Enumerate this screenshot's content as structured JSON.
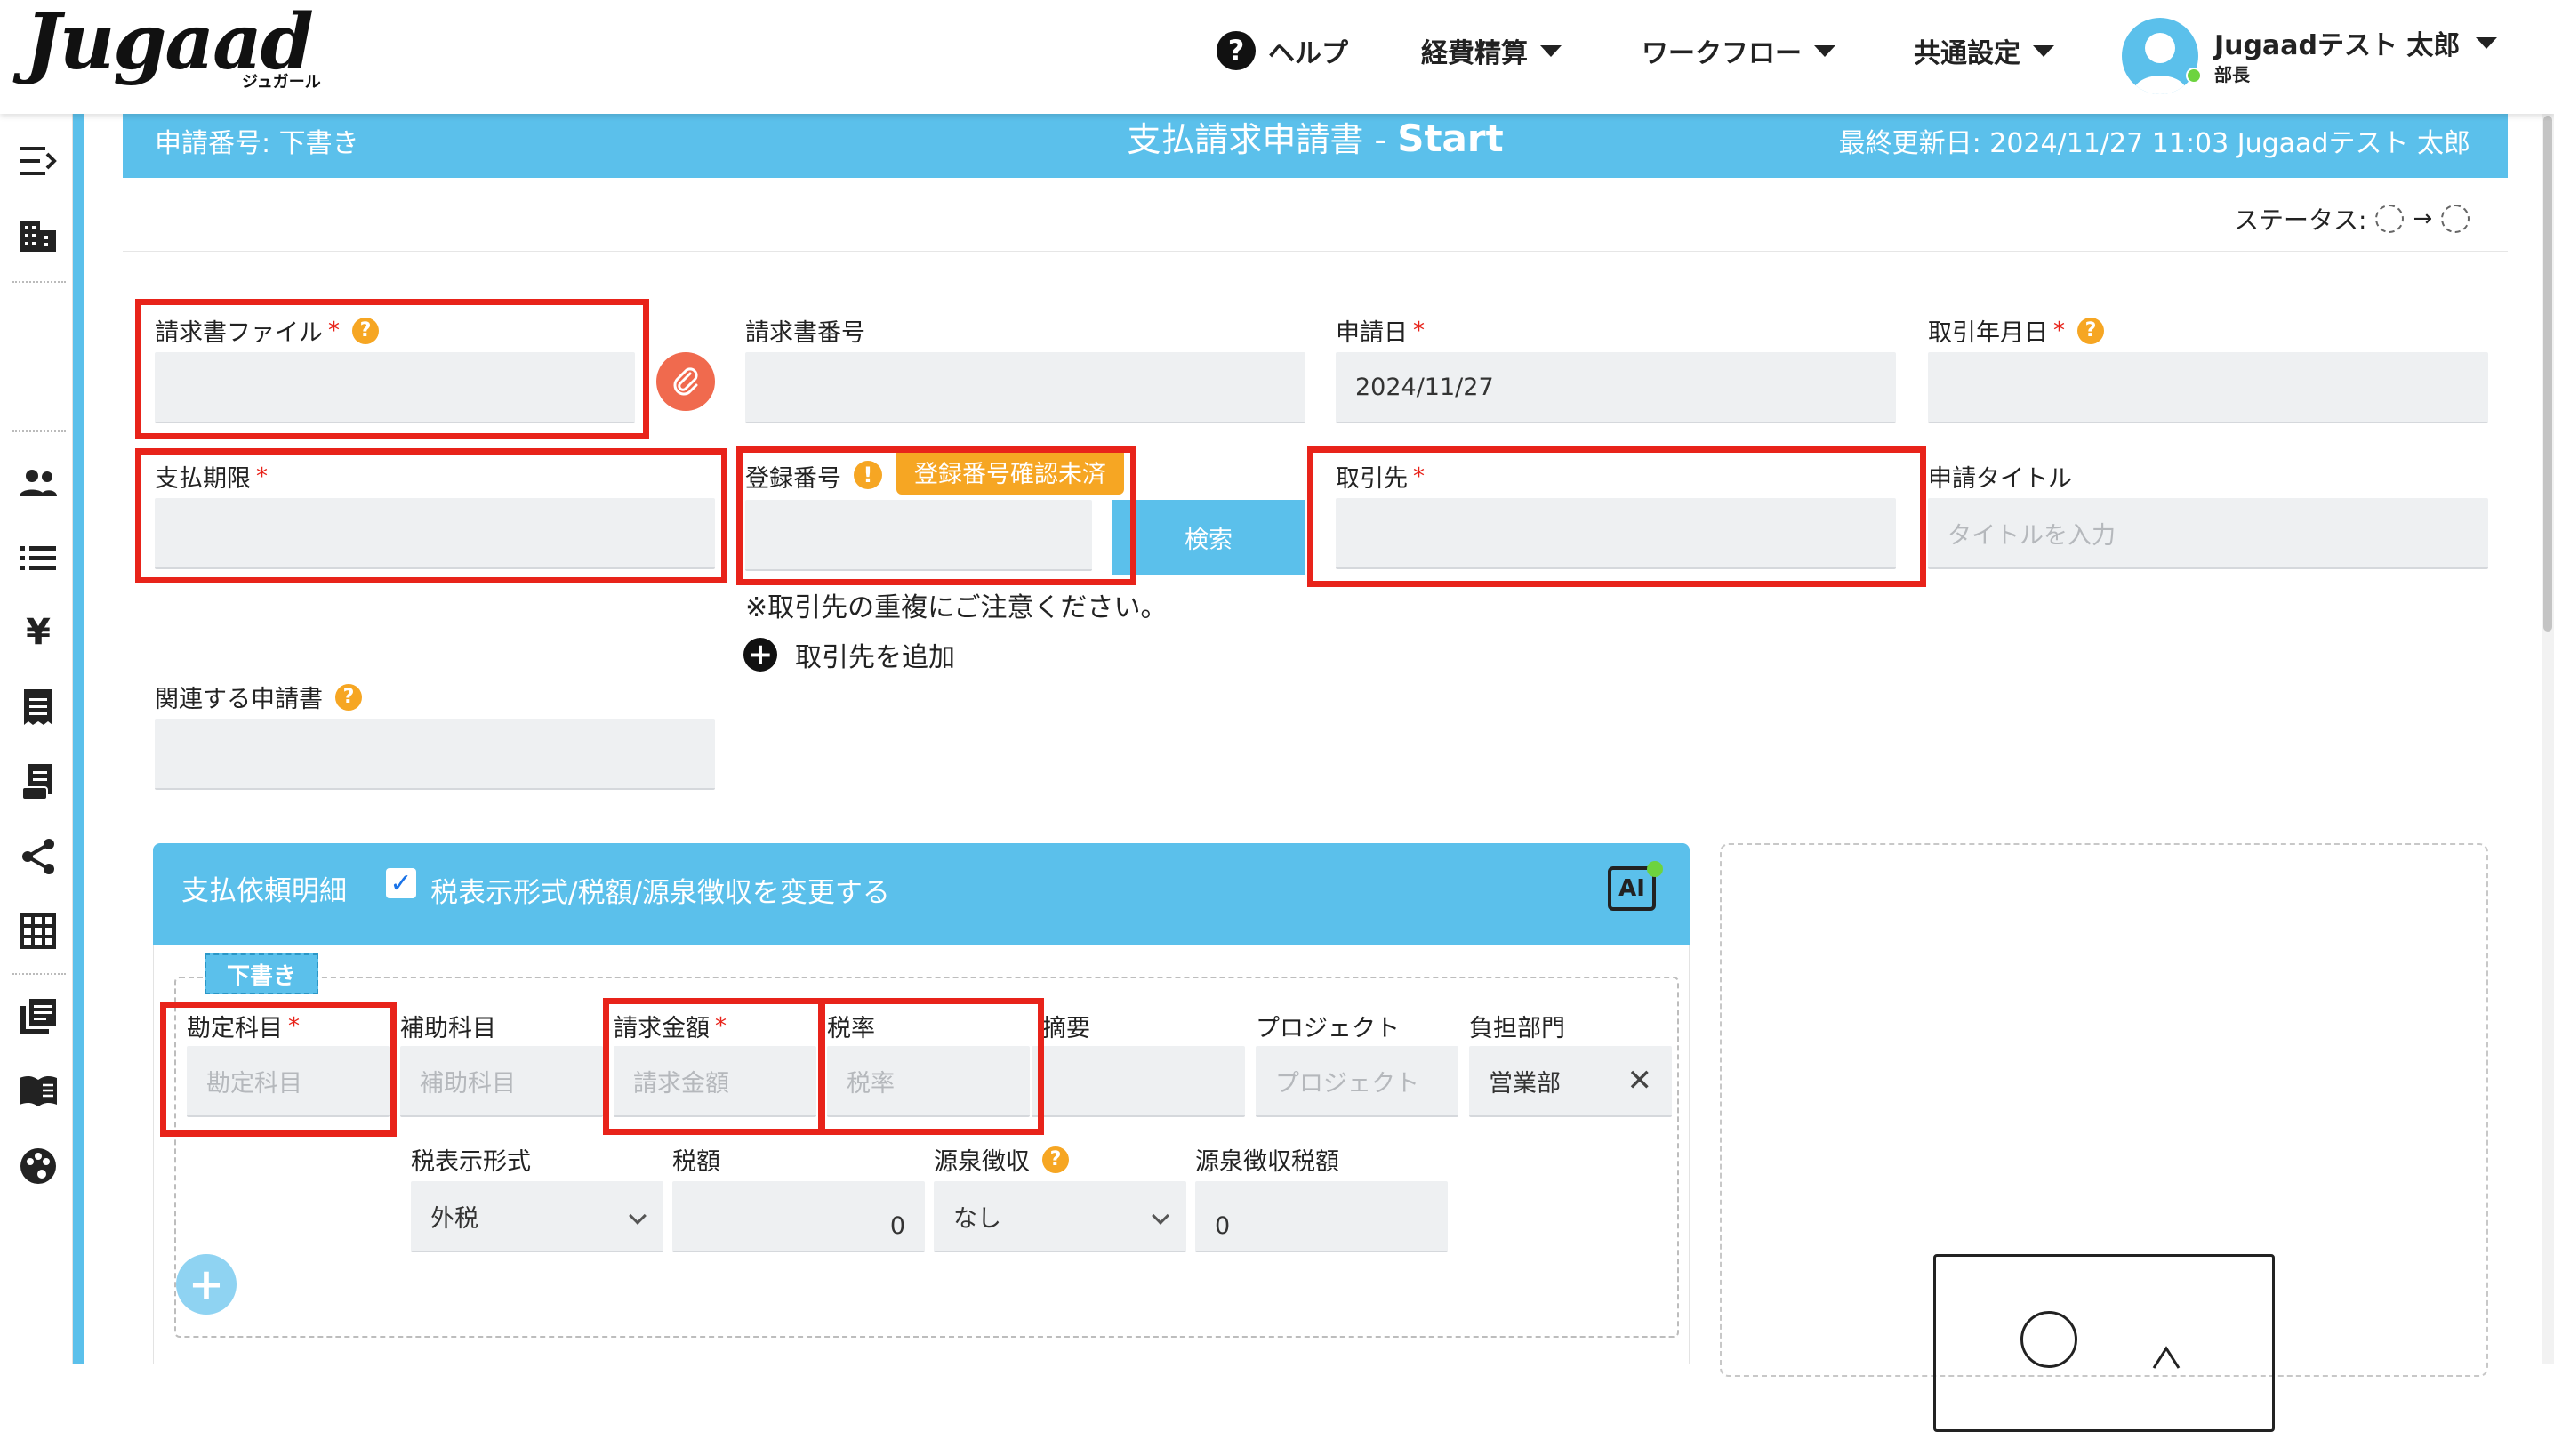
{
  "header": {
    "logo": "Jugaad",
    "logo_sub": "ジュガール",
    "help": "ヘルプ",
    "nav": [
      "経費精算",
      "ワークフロー",
      "共通設定"
    ],
    "user_name": "Jugaadテスト 太郎",
    "user_role": "部長"
  },
  "sidebar": {
    "icons": [
      "collapse-menu-icon",
      "building-icon",
      "people-icon",
      "list-icon",
      "yen-icon",
      "receipt-icon",
      "invoice-icon",
      "share-icon",
      "grid-icon",
      "library-icon",
      "book-icon",
      "palette-icon"
    ]
  },
  "form_header": {
    "application_number": "申請番号: 下書き",
    "title_prefix": "支払請求申請書 -",
    "title_step": "Start",
    "last_updated": "最終更新日: 2024/11/27 11:03  Jugaadテスト 太郎",
    "status_label": "ステータス:"
  },
  "fields": {
    "invoice_file": {
      "label": "請求書ファイル",
      "value": ""
    },
    "invoice_number": {
      "label": "請求書番号",
      "value": ""
    },
    "application_date": {
      "label": "申請日",
      "value": "2024/11/27"
    },
    "transaction_date": {
      "label": "取引年月日",
      "value": ""
    },
    "payment_due": {
      "label": "支払期限",
      "value": ""
    },
    "registration_number": {
      "label": "登録番号",
      "value": "",
      "warning": "登録番号確認未済"
    },
    "search_button": "検索",
    "vendor": {
      "label": "取引先",
      "value": ""
    },
    "request_title": {
      "label": "申請タイトル",
      "placeholder": "タイトルを入力"
    },
    "duplicate_note": "※取引先の重複にご注意ください。",
    "add_vendor": "取引先を追加",
    "related_applications": {
      "label": "関連する申請書",
      "value": ""
    }
  },
  "detail": {
    "title": "支払依頼明細",
    "checkbox_label": "税表示形式/税額/源泉徴収を変更する",
    "checkbox_checked": true,
    "draft_tag": "下書き",
    "ai_label": "AI",
    "row1": {
      "account": {
        "label": "勘定科目",
        "placeholder": "勘定科目"
      },
      "sub_account": {
        "label": "補助科目",
        "placeholder": "補助科目"
      },
      "amount": {
        "label": "請求金額",
        "placeholder": "請求金額"
      },
      "tax_rate": {
        "label": "税率",
        "placeholder": "税率"
      },
      "summary": {
        "label": "摘要",
        "value": ""
      },
      "project": {
        "label": "プロジェクト",
        "placeholder": "プロジェクト"
      },
      "department": {
        "label": "負担部門",
        "value": "営業部"
      }
    },
    "row2": {
      "tax_display": {
        "label": "税表示形式",
        "value": "外税"
      },
      "tax_amount": {
        "label": "税額",
        "value": "0"
      },
      "withholding": {
        "label": "源泉徴収",
        "value": "なし"
      },
      "withholding_amount": {
        "label": "源泉徴収税額",
        "value": "0"
      }
    }
  },
  "colors": {
    "accent": "#5bc0eb",
    "required": "#e8231a",
    "warning": "#f6a623",
    "highlight_box": "#e8231a"
  }
}
